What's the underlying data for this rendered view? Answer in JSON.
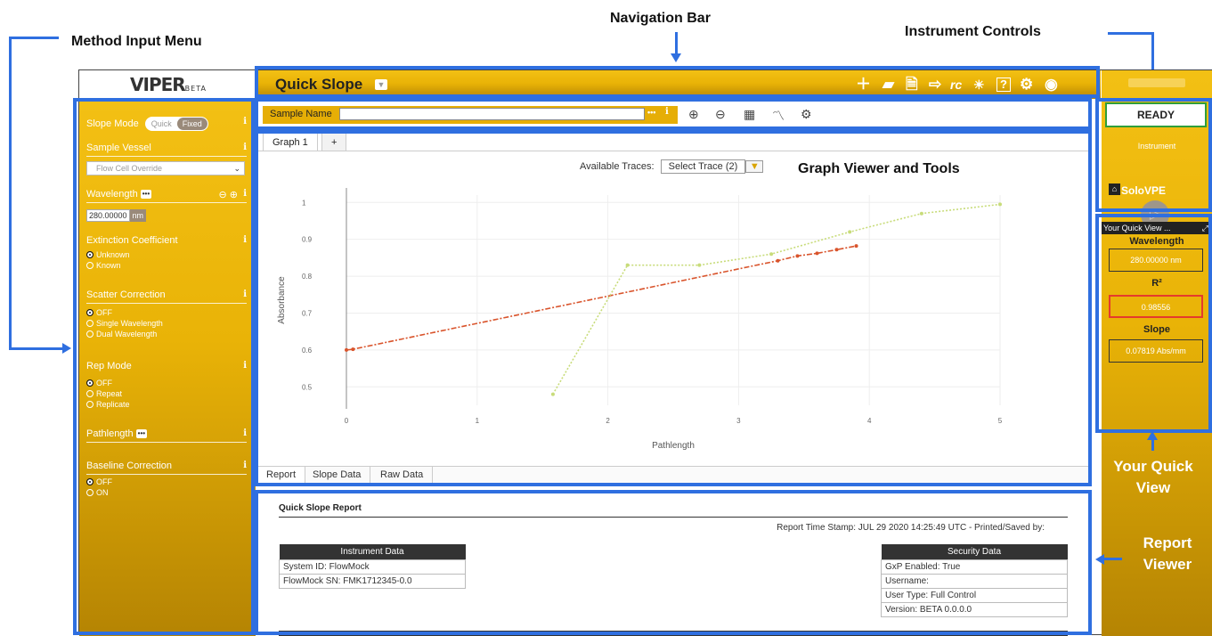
{
  "callouts": {
    "navigation_bar": "Navigation Bar",
    "method_input_menu": "Method Input Menu",
    "instrument_controls": "Instrument Controls",
    "graph_viewer": "Graph Viewer and Tools",
    "your_quick_view": "Your Quick View",
    "report_viewer": "Report Viewer"
  },
  "colors": {
    "accent_gold": "#e9b307",
    "annotation_blue": "#2f6fe0",
    "ready_border": "#2f9e3a",
    "highlight_red": "#e53b2c",
    "trace_red": "#d9542c",
    "trace_green": "#c8dc7a"
  },
  "logo": {
    "text": "VIPER",
    "suffix": "BETA"
  },
  "navbar": {
    "title": "Quick Slope",
    "icons": [
      "plus-icon",
      "folder-icon",
      "save-icon",
      "export-icon",
      "rc-icon",
      "lamp-icon",
      "help-icon",
      "gear-icon",
      "user-icon"
    ]
  },
  "leftmenu": {
    "slope_mode_label": "Slope Mode",
    "slope_mode_options": [
      "Quick",
      "Fixed"
    ],
    "sample_vessel_label": "Sample Vessel",
    "sample_vessel_value": "Flow Cell Override",
    "wavelength_label": "Wavelength",
    "wavelength_value": "280.00000",
    "wavelength_unit": "nm",
    "extinction_label": "Extinction Coefficient",
    "extinction_options": [
      "Unknown",
      "Known"
    ],
    "scatter_label": "Scatter Correction",
    "scatter_options": [
      "OFF",
      "Single Wavelength",
      "Dual Wavelength"
    ],
    "rep_mode_label": "Rep Mode",
    "rep_mode_options": [
      "OFF",
      "Repeat",
      "Replicate"
    ],
    "pathlength_label": "Pathlength",
    "baseline_label": "Baseline Correction",
    "baseline_options": [
      "OFF",
      "ON"
    ],
    "info_glyph": "i",
    "dots_glyph": "•••",
    "wl_controls": "⊖ ⊕"
  },
  "samplebar": {
    "label": "Sample Name",
    "value": "",
    "dots": "•••",
    "info": "i",
    "tools": [
      "zoom-in-icon",
      "zoom-out-icon",
      "calculator-icon",
      "chart-icon",
      "settings-icon"
    ]
  },
  "graph": {
    "tabs": [
      "Graph 1",
      "+"
    ],
    "available_traces_label": "Available Traces:",
    "select_trace_value": "Select Trace  (2)",
    "bottom_tabs": [
      "Report",
      "Slope Data",
      "Raw Data"
    ]
  },
  "chart_data": {
    "type": "line",
    "title": "",
    "xlabel": "Pathlength",
    "ylabel": "Absorbance",
    "xlim": [
      0,
      5
    ],
    "ylim": [
      0.45,
      1.02
    ],
    "xticks": [
      "0",
      "1",
      "2",
      "3",
      "4",
      "5"
    ],
    "yticks": [
      "0.5",
      "0.6",
      "0.7",
      "0.8",
      "0.9",
      "1"
    ],
    "grid": true,
    "series": [
      {
        "color": "#d9542c",
        "style": "dash-dot",
        "x": [
          0,
          0.05,
          3.3,
          3.45,
          3.6,
          3.75,
          3.9
        ],
        "y": [
          0.6,
          0.602,
          0.842,
          0.855,
          0.862,
          0.872,
          0.882
        ]
      },
      {
        "color": "#c8dc7a",
        "style": "dotted",
        "x": [
          1.58,
          2.15,
          2.7,
          3.25,
          3.85,
          4.4,
          5.0
        ],
        "y": [
          0.48,
          0.83,
          0.83,
          0.86,
          0.92,
          0.97,
          0.995
        ]
      }
    ]
  },
  "report": {
    "title": "Quick Slope Report",
    "stamp": "Report Time Stamp: JUL 29 2020 14:25:49 UTC - Printed/Saved by:",
    "instrument_header": "Instrument Data",
    "instrument_rows": [
      "System ID: FlowMock",
      "FlowMock SN: FMK1712345-0.0"
    ],
    "security_header": "Security Data",
    "security_rows": [
      "GxP Enabled: True",
      "Username:",
      "User Type: Full Control",
      "Version: BETA 0.0.0.0"
    ]
  },
  "rightpanel": {
    "status": "READY",
    "instrument_label": "Instrument",
    "instrument_name": "SoloVPE",
    "quickview_title": "Your Quick View ...",
    "wavelength_label": "Wavelength",
    "wavelength_value": "280.00000 nm",
    "r2_label": "R²",
    "r2_value": "0.98556",
    "slope_label": "Slope",
    "slope_value": "0.07819 Abs/mm"
  }
}
